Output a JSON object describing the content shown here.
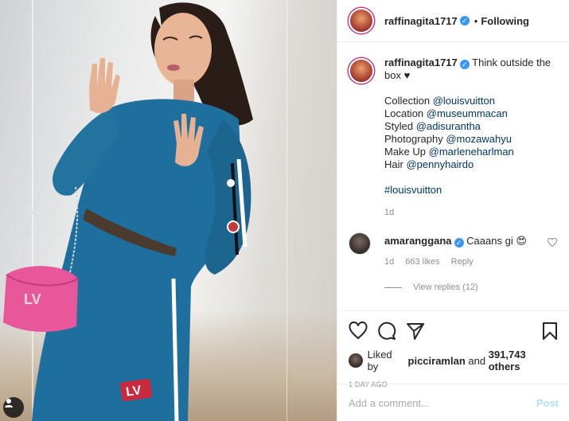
{
  "post": {
    "username": "raffinagita1717",
    "follow_status": "Following",
    "caption": {
      "username": "raffinagita1717",
      "first_line": "Think outside the box ♥",
      "credits": [
        {
          "label": "Collection",
          "handle": "@louisvuitton"
        },
        {
          "label": "Location",
          "handle": "@museummacan"
        },
        {
          "label": "Styled",
          "handle": "@adisurantha"
        },
        {
          "label": "Photography",
          "handle": "@mozawahyu"
        },
        {
          "label": "Make Up",
          "handle": "@marleneharlman"
        },
        {
          "label": "Hair",
          "handle": "@pennyhairdo"
        }
      ],
      "hashtag": "#louisvuitton",
      "time": "1d"
    },
    "comment": {
      "username": "amaranggana",
      "text": "Caaans gi 😍",
      "time": "1d",
      "likes": "663 likes",
      "reply": "Reply",
      "view_replies": "View replies (12)"
    },
    "liked_by": {
      "prefix": "Liked by",
      "user": "picciramlan",
      "middle": "and",
      "others": "391,743 others"
    },
    "timestamp": "1 DAY AGO",
    "add_comment_placeholder": "Add a comment...",
    "post_button": "Post"
  },
  "colors": {
    "verified": "#3897f0",
    "mention": "#003569",
    "dress": "#1f6f9e",
    "bag": "#e8579a"
  },
  "icons": [
    "verified-icon",
    "heart-icon",
    "comment-icon",
    "share-icon",
    "bookmark-icon",
    "more-dots-icon"
  ]
}
